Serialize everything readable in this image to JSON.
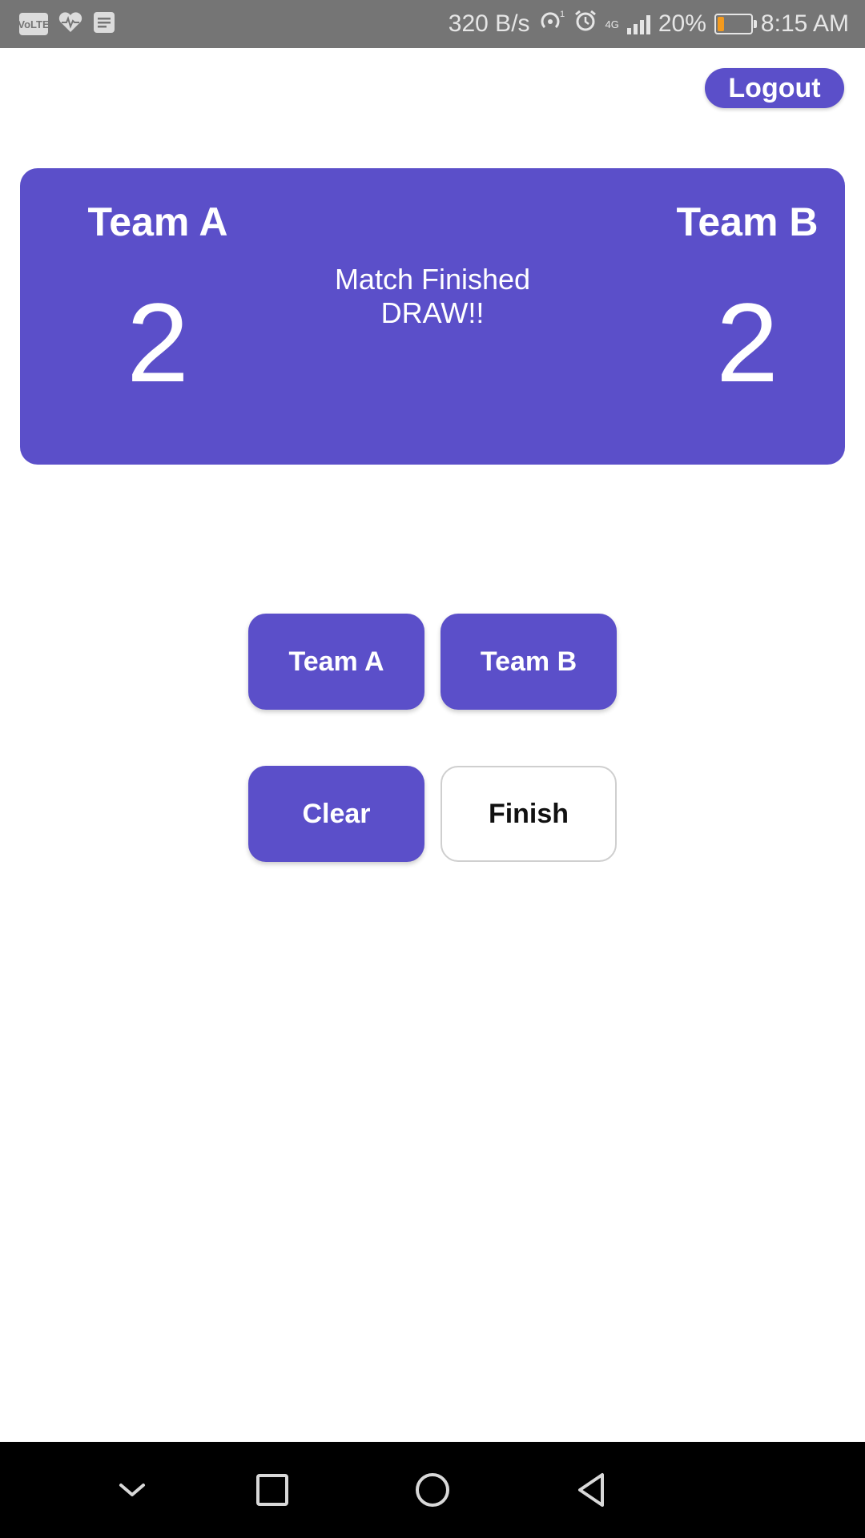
{
  "status_bar": {
    "left_icons": [
      "volte-icon",
      "health-icon",
      "notes-icon"
    ],
    "left_labels": {
      "volte": "VoLTE"
    },
    "speed": "320 B/s",
    "network": "4G",
    "battery": "20%",
    "battery_level": 0.2,
    "time": "8:15 AM"
  },
  "header": {
    "logout_label": "Logout"
  },
  "scoreboard": {
    "team_a": {
      "name": "Team A",
      "score": "2"
    },
    "team_b": {
      "name": "Team B",
      "score": "2"
    },
    "status_line1": "Match Finished",
    "status_line2": "DRAW!!"
  },
  "controls": {
    "team_a_label": "Team A",
    "team_b_label": "Team B",
    "clear_label": "Clear",
    "finish_label": "Finish"
  },
  "nav": {
    "icons": [
      "chevron-down-icon",
      "recents-square-icon",
      "home-circle-icon",
      "back-triangle-icon"
    ]
  },
  "colors": {
    "accent": "#5b4fc9",
    "status_bar": "#757575",
    "battery_low": "#f39a1e"
  }
}
